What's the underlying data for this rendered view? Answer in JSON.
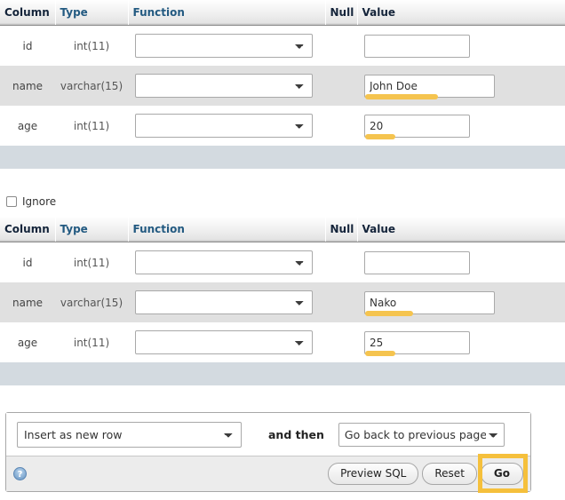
{
  "page": {
    "app": "phpMyAdmin",
    "screen": "insert-rows-form"
  },
  "table_headers": {
    "column": "Column",
    "type": "Type",
    "function": "Function",
    "null": "Null",
    "value": "Value"
  },
  "row_forms": [
    {
      "id": "row-form-1",
      "has_ignore": false,
      "fields": [
        {
          "column": "id",
          "type": "int(11)",
          "function": "",
          "value": "",
          "highlighted": false,
          "width": "narrow"
        },
        {
          "column": "name",
          "type": "varchar(15)",
          "function": "",
          "value": "John Doe",
          "highlighted": true,
          "width": "wide"
        },
        {
          "column": "age",
          "type": "int(11)",
          "function": "",
          "value": "20",
          "highlighted": true,
          "width": "narrow"
        }
      ]
    },
    {
      "id": "row-form-2",
      "has_ignore": true,
      "ignore_label": "Ignore",
      "ignore_checked": false,
      "fields": [
        {
          "column": "id",
          "type": "int(11)",
          "function": "",
          "value": "",
          "highlighted": false,
          "width": "narrow"
        },
        {
          "column": "name",
          "type": "varchar(15)",
          "function": "",
          "value": "Nako",
          "highlighted": true,
          "width": "wide"
        },
        {
          "column": "age",
          "type": "int(11)",
          "function": "",
          "value": "25",
          "highlighted": true,
          "width": "narrow"
        }
      ]
    }
  ],
  "actions": {
    "insert_mode_selected": "Insert as new row",
    "and_then_label": "and then",
    "after_insert_selected": "Go back to previous page",
    "help_icon": "question-mark-icon",
    "preview_sql_label": "Preview SQL",
    "reset_label": "Reset",
    "go_label": "Go"
  },
  "colors": {
    "highlight_gold": "#f5c44f",
    "go_annotation": "#f5c03c",
    "header_text_dark": "#14243a",
    "header_text_link": "#235a81",
    "row_alt_bg": "#e0e0e0",
    "footer_band": "#d3dae0",
    "action_bar_bg": "#ececec"
  }
}
